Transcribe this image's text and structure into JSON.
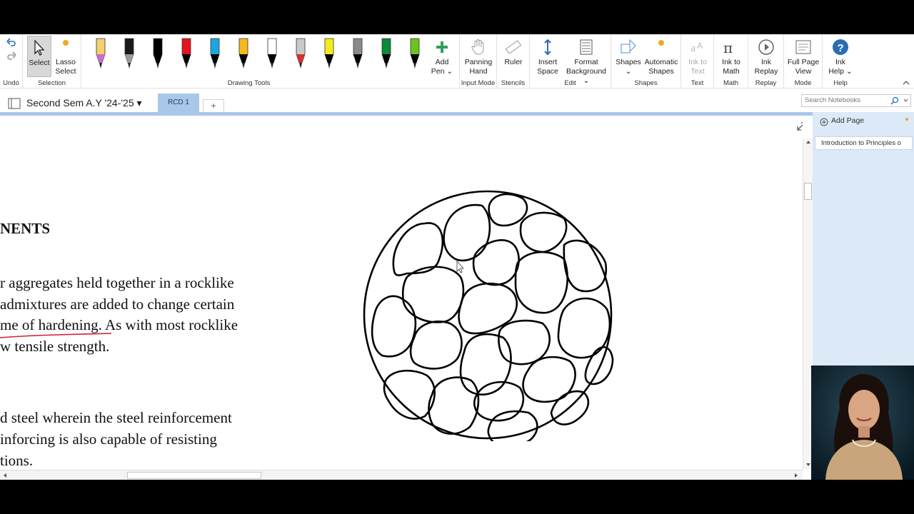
{
  "ribbon": {
    "undo": {
      "label": "Undo",
      "group": "Undo"
    },
    "selection": {
      "select": "Select",
      "lasso1": "Lasso",
      "lasso2": "Select",
      "group": "Selection"
    },
    "drawing": {
      "group": "Drawing Tools",
      "add_pen1": "Add",
      "add_pen2": "Pen ⌄"
    },
    "input_mode": {
      "label1": "Panning",
      "label2": "Hand",
      "group": "Input Mode"
    },
    "stencils": {
      "label": "Ruler",
      "group": "Stencils"
    },
    "edit": {
      "insert1": "Insert",
      "insert2": "Space",
      "format1": "Format",
      "format2": "Background ⌄",
      "group": "Edit"
    },
    "shapes": {
      "shapes1": "Shapes",
      "shapes2": "⌄",
      "auto1": "Automatic",
      "auto2": "Shapes",
      "group": "Shapes"
    },
    "text": {
      "label1": "Ink to",
      "label2": "Text",
      "group": "Text"
    },
    "math": {
      "label1": "Ink to",
      "label2": "Math",
      "group": "Math"
    },
    "replay": {
      "label1": "Ink",
      "label2": "Replay",
      "group": "Replay"
    },
    "mode": {
      "label1": "Full Page",
      "label2": "View",
      "group": "Mode"
    },
    "help": {
      "label1": "Ink",
      "label2": "Help ⌄",
      "group": "Help"
    }
  },
  "pens": [
    {
      "color": "#f4d06f",
      "cap": "#c86bd6"
    },
    {
      "color": "#1a1a1a",
      "cap": "#9a9a9a"
    },
    {
      "color": "#000000",
      "cap": "#000000"
    },
    {
      "color": "#e4141c",
      "cap": "#000000"
    },
    {
      "color": "#1ca6e0",
      "cap": "#000000"
    },
    {
      "color": "#f6b81d",
      "cap": "#000000"
    },
    {
      "color": "#ffffff",
      "cap": "#000000"
    },
    {
      "color": "#c9c9c9",
      "cap": "#d43030"
    },
    {
      "color": "#f4ec1a",
      "cap": "#000000"
    },
    {
      "color": "#8a8a8a",
      "cap": "#000000"
    },
    {
      "color": "#0a8a3a",
      "cap": "#000000"
    },
    {
      "color": "#6cc51e",
      "cap": "#000000"
    }
  ],
  "notebook": {
    "title": "Second Sem A.Y '24-'25 ▾",
    "active_tab": "RCD 1",
    "add_tab": "+"
  },
  "search": {
    "placeholder": "Search Notebooks"
  },
  "pages": {
    "add_page": "Add Page",
    "items": [
      "Introduction to Principles o"
    ]
  },
  "document": {
    "heading": "NENTS",
    "paragraph1": [
      "r aggregates held together in a rocklike",
      "admixtures are added to change certain",
      "me of hardening. As with most rocklike",
      "w tensile strength."
    ],
    "paragraph2": [
      "d steel wherein the steel reinforcement",
      "inforcing is also capable of resisting",
      "tions."
    ]
  },
  "colors": {
    "accent": "#a9c7e8",
    "pane": "#dce9f6",
    "underline": "#d21e2e"
  }
}
